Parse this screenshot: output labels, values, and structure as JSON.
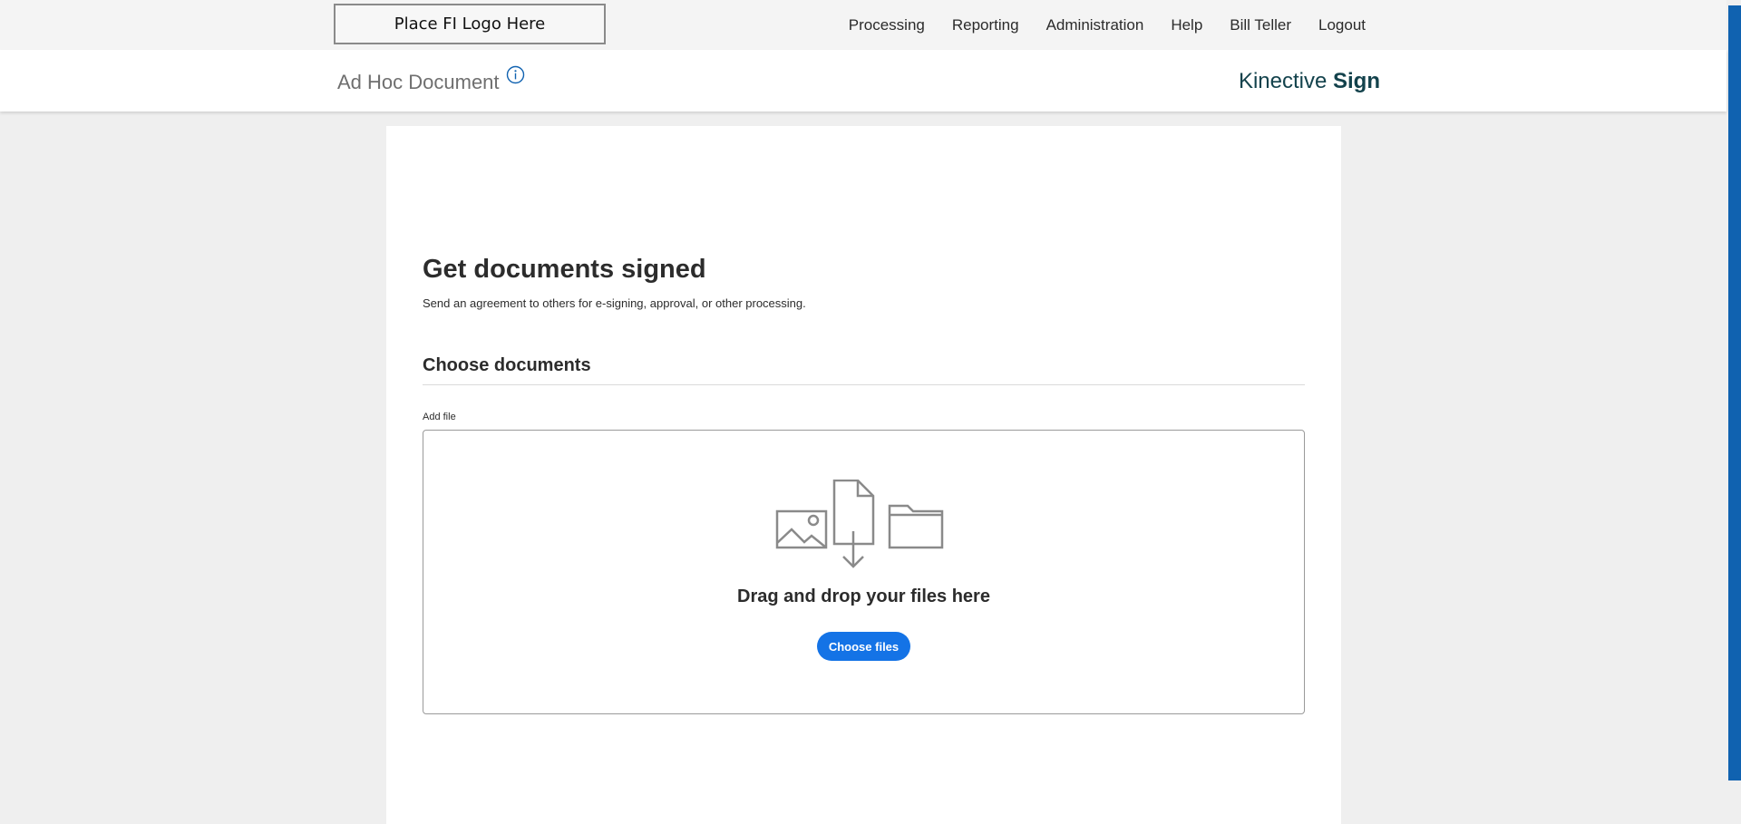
{
  "topbar": {
    "logo_text": "Place FI Logo Here",
    "nav": [
      "Processing",
      "Reporting",
      "Administration",
      "Help",
      "Bill Teller",
      "Logout"
    ]
  },
  "subheader": {
    "title": "Ad Hoc Document",
    "info_icon": "info-icon",
    "brand_prefix": "Kinective",
    "brand_suffix": "Sign"
  },
  "main": {
    "heading": "Get documents signed",
    "subtext": "Send an agreement to others for e-signing, approval, or other processing.",
    "section_title": "Choose documents",
    "add_file_label": "Add file",
    "dropzone": {
      "icons": [
        "image-icon",
        "file-download-icon",
        "folder-icon"
      ],
      "text": "Drag and drop your files here",
      "button_label": "Choose files"
    }
  },
  "colors": {
    "accent": "#1473e6",
    "brand": "#13424c",
    "edge_bar": "#1062b0"
  }
}
